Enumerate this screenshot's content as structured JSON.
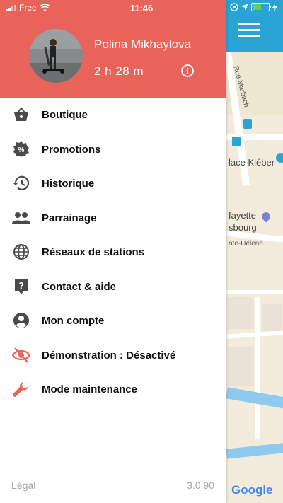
{
  "status_bar": {
    "carrier": "Free",
    "time": "11:46"
  },
  "user": {
    "name": "Polina Mikhaylova",
    "time_balance": "2 h 28 m"
  },
  "menu": [
    {
      "label": "Boutique",
      "icon": "basket-icon"
    },
    {
      "label": "Promotions",
      "icon": "discount-badge-icon"
    },
    {
      "label": "Historique",
      "icon": "history-icon"
    },
    {
      "label": "Parrainage",
      "icon": "people-icon"
    },
    {
      "label": "Réseaux de stations",
      "icon": "globe-icon"
    },
    {
      "label": "Contact & aide",
      "icon": "help-icon"
    },
    {
      "label": "Mon compte",
      "icon": "account-icon"
    },
    {
      "label": "Démonstration : Désactivé",
      "icon": "eye-off-icon"
    },
    {
      "label": "Mode maintenance",
      "icon": "wrench-icon"
    }
  ],
  "footer": {
    "legal": "Légal",
    "version": "3.0.90"
  },
  "map": {
    "labels": [
      "Rue Marbach",
      "lace Kléber",
      "fayette",
      "sbourg",
      "nte-Hélène"
    ],
    "attribution": "Google"
  },
  "colors": {
    "header": "#e8645a",
    "topbar": "#2aa3d5",
    "demo_icon": "#e8645a",
    "wrench_icon": "#e8645a"
  }
}
